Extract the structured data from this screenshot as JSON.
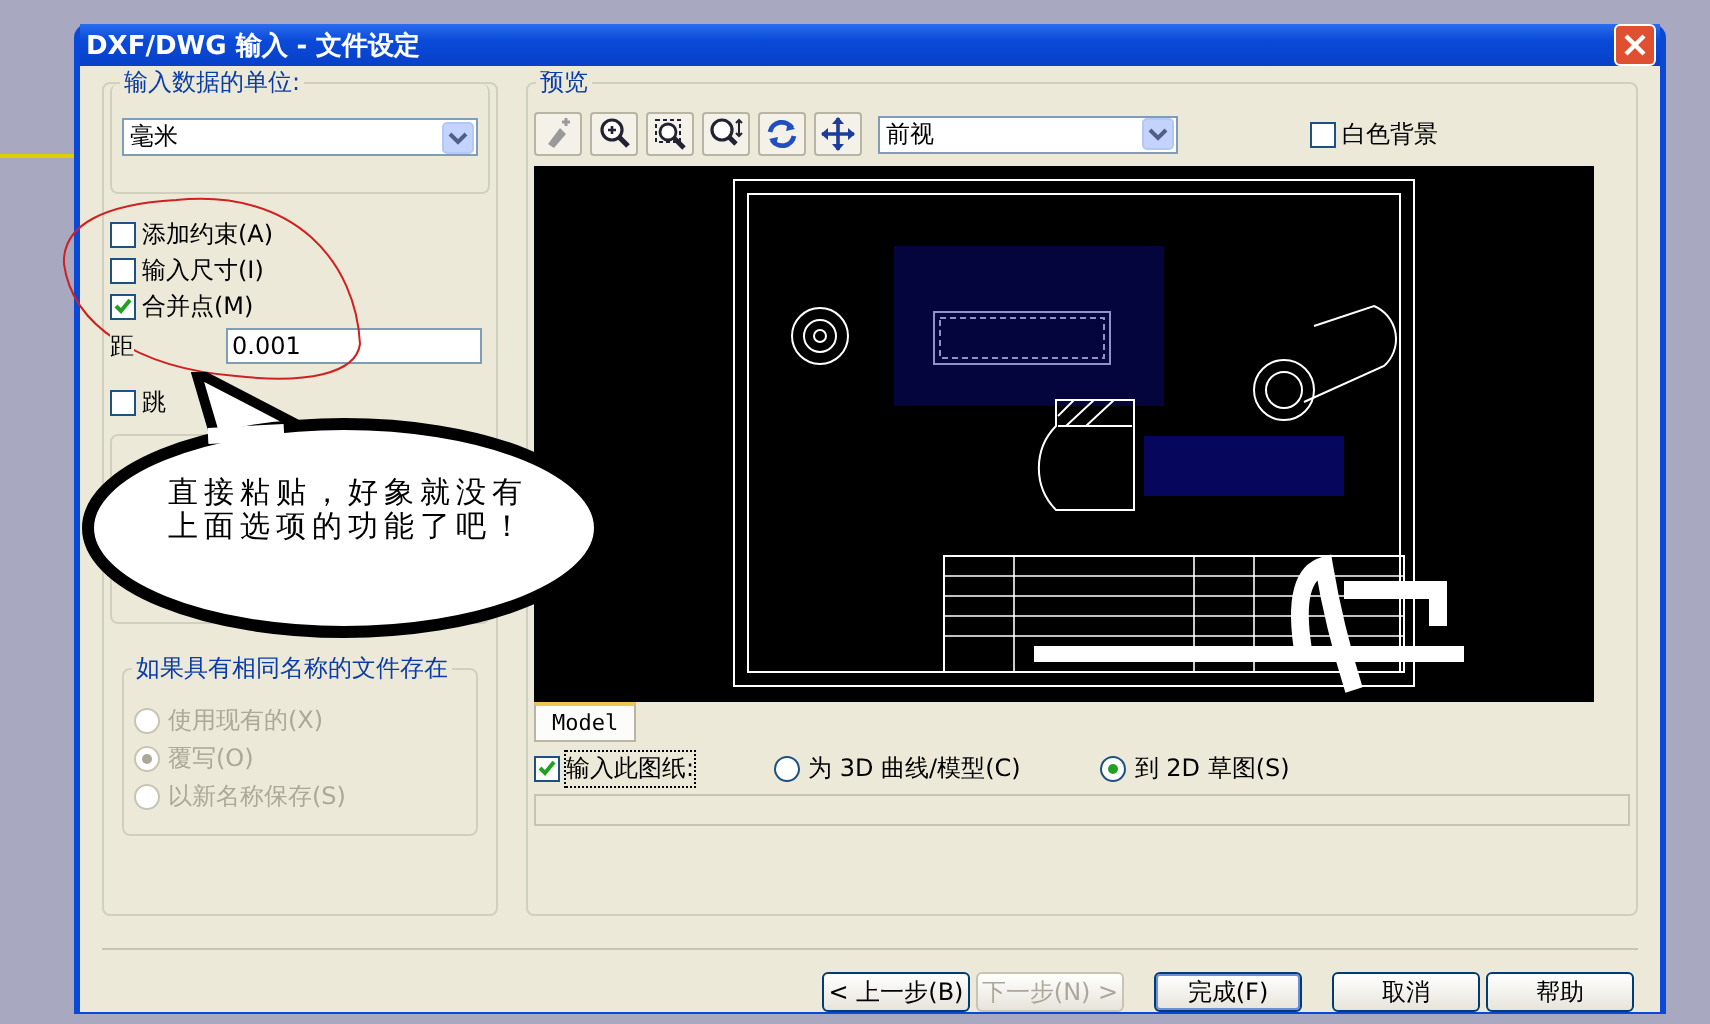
{
  "window": {
    "title": "DXF/DWG 输入 - 文件设定"
  },
  "units": {
    "label": "输入数据的单位:",
    "value": "毫米"
  },
  "options": [
    {
      "label": "添加约束(A)",
      "checked": false
    },
    {
      "label": "输入尺寸(I)",
      "checked": false
    },
    {
      "label": "合并点(M)",
      "checked": true
    }
  ],
  "distance": {
    "label": "距",
    "value": "0.001"
  },
  "skip_option": {
    "label": "跳",
    "checked": false
  },
  "existing_file": {
    "label": "如果具有相同名称的文件存在",
    "options": [
      {
        "label": "使用现有的(X)",
        "selected": false
      },
      {
        "label": "覆写(O)",
        "selected": true
      },
      {
        "label": "以新名称保存(S)",
        "selected": false
      }
    ]
  },
  "preview": {
    "label": "预览",
    "view": "前视",
    "white_background": {
      "label": "白色背景",
      "checked": false
    },
    "tabs": [
      {
        "label": "Model",
        "selected": true
      }
    ],
    "import_sheet": {
      "label": "输入此图纸:",
      "checked": true
    },
    "targets": [
      {
        "label": "为 3D 曲线/模型(C)",
        "selected": false
      },
      {
        "label": "到 2D 草图(S)",
        "selected": true
      }
    ]
  },
  "callout": {
    "text": "直接粘贴，好象就没有上面选项的功能了吧！"
  },
  "buttons": [
    {
      "label": "< 上一步(B)",
      "disabled": false
    },
    {
      "label": "下一步(N) >",
      "disabled": true
    },
    {
      "label": "完成(F)",
      "disabled": false
    },
    {
      "label": "取消",
      "disabled": false
    },
    {
      "label": "帮助",
      "disabled": false
    }
  ]
}
